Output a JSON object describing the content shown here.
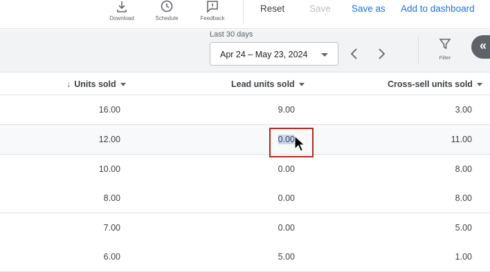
{
  "toolbar": {
    "download_label": "Download",
    "schedule_label": "Schedule",
    "feedback_label": "Feedback",
    "reset_label": "Reset",
    "save_label": "Save",
    "save_as_label": "Save as",
    "add_to_dashboard_label": "Add to dashboard"
  },
  "filters": {
    "date_caption": "Last 30 days",
    "date_range": "Apr 24 – May 23, 2024",
    "filter_label": "Filter",
    "collapse_glyph": "«"
  },
  "table": {
    "columns": [
      {
        "label": "Units sold",
        "sort_icon": "arrow-down-icon",
        "sorted": true
      },
      {
        "label": "Lead units sold"
      },
      {
        "label": "Cross-sell units sold"
      }
    ],
    "rows": [
      [
        "16.00",
        "9.00",
        "3.00"
      ],
      [
        "12.00",
        "0.00",
        "11.00"
      ],
      [
        "10.00",
        "0.00",
        "8.00"
      ],
      [
        "8.00",
        "0.00",
        "8.00"
      ],
      [
        "7.00",
        "0.00",
        "5.00"
      ],
      [
        "6.00",
        "5.00",
        "1.00"
      ]
    ]
  },
  "colors": {
    "accent": "#1a73e8",
    "disabled": "#bdc1c6",
    "focus_outline": "#b3261e",
    "text_selection": "#c8d7f5"
  }
}
